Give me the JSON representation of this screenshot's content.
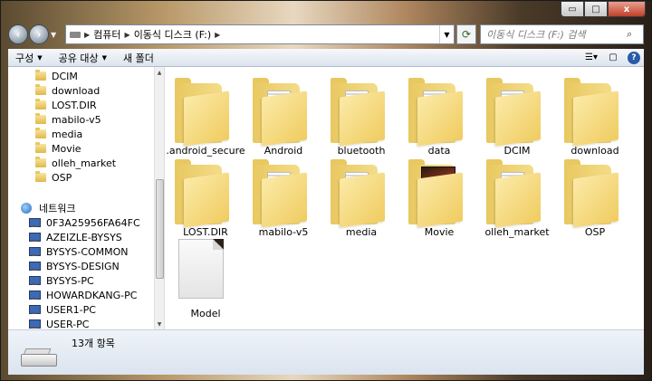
{
  "window": {
    "caption_minimize": "▭",
    "caption_maximize": "□",
    "caption_close": "x"
  },
  "address": {
    "back_icon": "‹",
    "forward_icon": "›",
    "crumbs": [
      "컴퓨터",
      "이동식 디스크 (F:)"
    ],
    "search_placeholder": "이동식 디스크 (F:) 검색"
  },
  "toolbar": {
    "organize_label": "구성",
    "share_label": "공유 대상",
    "new_folder_label": "새 폴더"
  },
  "nav_pane": {
    "folders": [
      "DCIM",
      "download",
      "LOST.DIR",
      "mabilo-v5",
      "media",
      "Movie",
      "olleh_market",
      "OSP"
    ],
    "network_label": "네트워크",
    "network_items": [
      "0F3A25956FA64FC",
      "AZEIZLE-BYSYS",
      "BYSYS-COMMON",
      "BYSYS-DESIGN",
      "BYSYS-PC",
      "HOWARDKANG-PC",
      "USER1-PC",
      "USER-PC"
    ]
  },
  "content": {
    "items": [
      {
        "name": ".android_secure",
        "type": "folder"
      },
      {
        "name": "Android",
        "type": "folder-docs"
      },
      {
        "name": "bluetooth",
        "type": "folder-docs"
      },
      {
        "name": "data",
        "type": "folder-docs"
      },
      {
        "name": "DCIM",
        "type": "folder-docs"
      },
      {
        "name": "download",
        "type": "folder"
      },
      {
        "name": "LOST.DIR",
        "type": "folder"
      },
      {
        "name": "mabilo-v5",
        "type": "folder-docs"
      },
      {
        "name": "media",
        "type": "folder-docs"
      },
      {
        "name": "Movie",
        "type": "folder-photo"
      },
      {
        "name": "olleh_market",
        "type": "folder-docs"
      },
      {
        "name": "OSP",
        "type": "folder"
      },
      {
        "name": "Model",
        "type": "file"
      }
    ]
  },
  "status": {
    "item_count": "13개 항목"
  }
}
